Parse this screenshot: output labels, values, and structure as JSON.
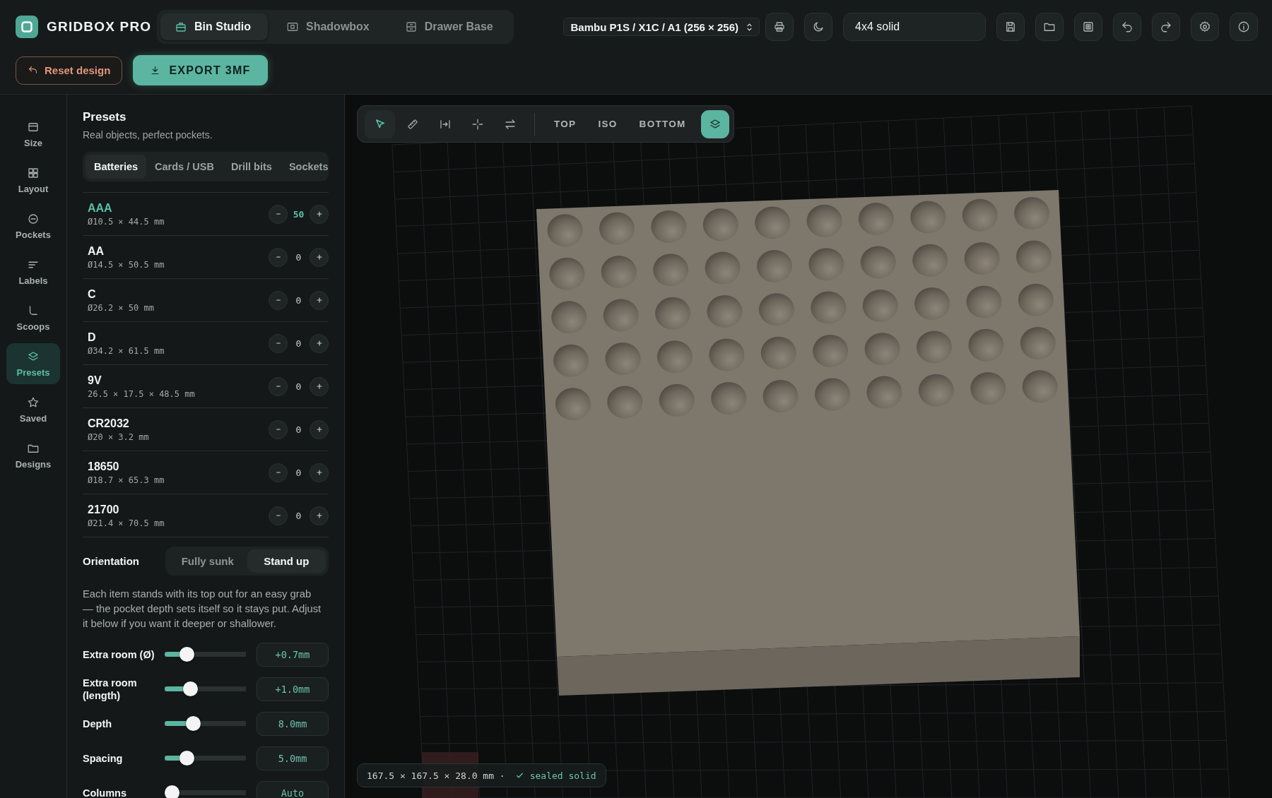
{
  "app": {
    "name": "GRIDBOX PRO"
  },
  "mode_tabs": [
    {
      "label": "Bin Studio",
      "selected": true
    },
    {
      "label": "Shadowbox",
      "selected": false
    },
    {
      "label": "Drawer Base",
      "selected": false
    }
  ],
  "printer_select": {
    "value": "Bambu P1S / X1C / A1 (256 × 256)"
  },
  "design_name": {
    "value": "4x4 solid"
  },
  "reset_button": {
    "label": "Reset design"
  },
  "export_button": {
    "label": "EXPORT 3MF"
  },
  "rail": [
    {
      "label": "Size",
      "selected": false
    },
    {
      "label": "Layout",
      "selected": false
    },
    {
      "label": "Pockets",
      "selected": false
    },
    {
      "label": "Labels",
      "selected": false
    },
    {
      "label": "Scoops",
      "selected": false
    },
    {
      "label": "Presets",
      "selected": true
    },
    {
      "label": "Saved",
      "selected": false
    },
    {
      "label": "Designs",
      "selected": false
    }
  ],
  "panel": {
    "title": "Presets",
    "subtitle": "Real objects, perfect pockets.",
    "category_tabs": [
      {
        "label": "Batteries",
        "selected": true
      },
      {
        "label": "Cards / USB",
        "selected": false
      },
      {
        "label": "Drill bits",
        "selected": false
      },
      {
        "label": "Sockets",
        "selected": false
      }
    ],
    "presets": [
      {
        "name": "AAA",
        "dims": "Ø10.5 × 44.5 mm",
        "count": "50",
        "selected": true
      },
      {
        "name": "AA",
        "dims": "Ø14.5 × 50.5 mm",
        "count": "0",
        "selected": false
      },
      {
        "name": "C",
        "dims": "Ø26.2 × 50 mm",
        "count": "0",
        "selected": false
      },
      {
        "name": "D",
        "dims": "Ø34.2 × 61.5 mm",
        "count": "0",
        "selected": false
      },
      {
        "name": "9V",
        "dims": "26.5 × 17.5 × 48.5 mm",
        "count": "0",
        "selected": false
      },
      {
        "name": "CR2032",
        "dims": "Ø20 × 3.2 mm",
        "count": "0",
        "selected": false
      },
      {
        "name": "18650",
        "dims": "Ø18.7 × 65.3 mm",
        "count": "0",
        "selected": false
      },
      {
        "name": "21700",
        "dims": "Ø21.4 × 70.5 mm",
        "count": "0",
        "selected": false
      }
    ],
    "orientation": {
      "label": "Orientation",
      "options": [
        {
          "label": "Fully sunk",
          "selected": false
        },
        {
          "label": "Stand up",
          "selected": true
        }
      ]
    },
    "description": "Each item stands with its top out for an easy grab — the pocket depth sets itself so it stays put. Adjust it below if you want it deeper or shallower.",
    "sliders": [
      {
        "label": "Extra room (Ø)",
        "level": 0.22,
        "value": "+0.7mm"
      },
      {
        "label": "Extra room (length)",
        "level": 0.28,
        "value": "+1.0mm"
      },
      {
        "label": "Depth",
        "level": 0.32,
        "value": "8.0mm"
      },
      {
        "label": "Spacing",
        "level": 0.22,
        "value": "5.0mm"
      },
      {
        "label": "Columns",
        "level": 0,
        "value": "Auto"
      }
    ]
  },
  "viewport": {
    "tools": [
      {
        "kind": "select",
        "selected": true
      },
      {
        "kind": "measure",
        "selected": false
      },
      {
        "kind": "fit",
        "selected": false
      },
      {
        "kind": "center",
        "selected": false
      },
      {
        "kind": "swap",
        "selected": false
      }
    ],
    "views": [
      {
        "label": "TOP"
      },
      {
        "label": "ISO"
      },
      {
        "label": "BOTTOM"
      }
    ],
    "layers_toggle": {
      "on": true
    },
    "status": {
      "dims": "167.5 × 167.5 × 28.0 mm ·",
      "check": "sealed solid"
    }
  }
}
